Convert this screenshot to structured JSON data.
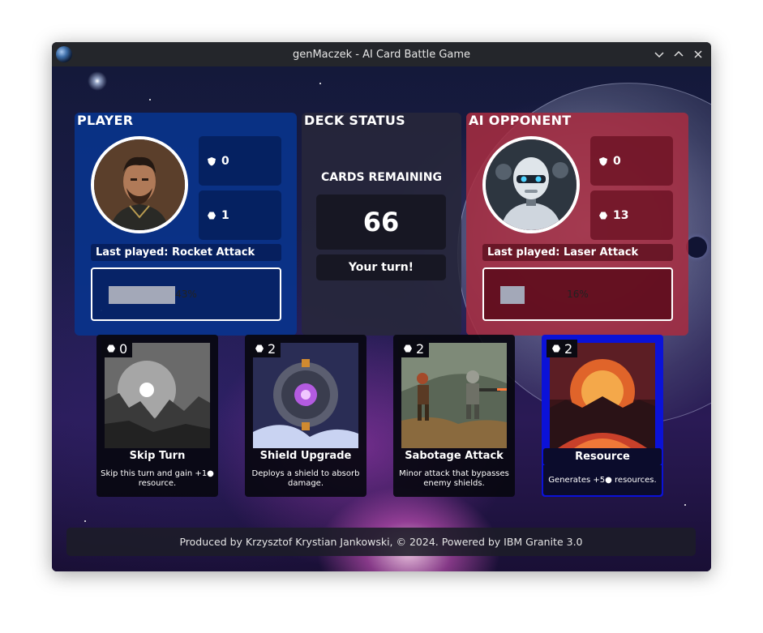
{
  "window": {
    "title": "genMaczek - AI Card Battle Game",
    "controls": [
      "minimize",
      "maximize",
      "close"
    ]
  },
  "player": {
    "title": "PLAYER",
    "shield": "0",
    "resources": "1",
    "last_played": "Last played: Rocket Attack",
    "progress_text": "43%",
    "progress_value": 43,
    "color": "#08348e"
  },
  "deck": {
    "title": "DECK STATUS",
    "cards_label": "CARDS REMAINING",
    "cards_remaining": "66",
    "turn": "Your turn!"
  },
  "ai": {
    "title": "AI OPPONENT",
    "shield": "0",
    "resources": "13",
    "last_played": "Last played: Laser Attack",
    "progress_text": "16%",
    "progress_value": 16,
    "color": "#a82c40"
  },
  "cards": [
    {
      "cost": "0",
      "name": "Skip Turn",
      "description": "Skip this turn and gain +1● resource.",
      "selected": false
    },
    {
      "cost": "2",
      "name": "Shield Upgrade",
      "description": "Deploys a shield to absorb damage.",
      "selected": false
    },
    {
      "cost": "2",
      "name": "Sabotage Attack",
      "description": "Minor attack that bypasses enemy shields.",
      "selected": false
    },
    {
      "cost": "2",
      "name": "Resource Generator",
      "description": "Generates +5● resources.",
      "selected": true
    }
  ],
  "footer": "Produced by Krzysztof Krystian Jankowski, © 2024. Powered by IBM Granite 3.0",
  "icons": {
    "shield": "shield-icon",
    "resource": "hexagon-icon"
  }
}
